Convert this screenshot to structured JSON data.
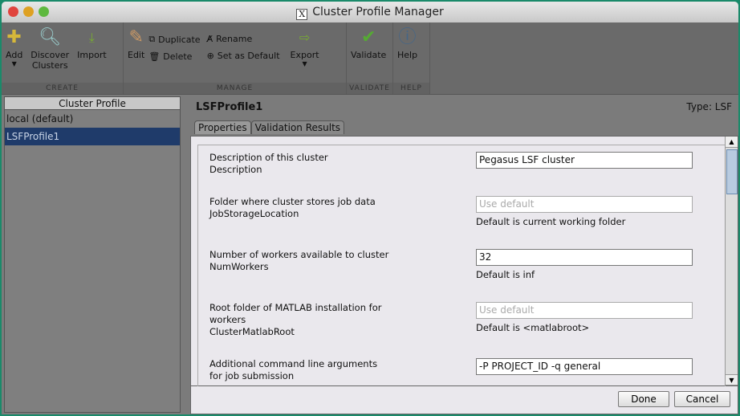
{
  "window": {
    "title": "Cluster Profile Manager",
    "title_icon": "X"
  },
  "toolbar": {
    "create": {
      "label": "CREATE",
      "add": "Add",
      "discover": "Discover\nClusters",
      "discover_l1": "Discover",
      "discover_l2": "Clusters",
      "import": "Import"
    },
    "manage": {
      "label": "MANAGE",
      "edit": "Edit",
      "duplicate": "Duplicate",
      "delete": "Delete",
      "rename": "Rename",
      "set_default": "Set as Default",
      "export": "Export"
    },
    "validate": {
      "label": "VALIDATE",
      "validate": "Validate"
    },
    "help": {
      "label": "HELP",
      "help": "Help"
    }
  },
  "sidebar": {
    "header": "Cluster Profile",
    "items": [
      {
        "label": "local (default)"
      },
      {
        "label": "LSFProfile1",
        "selected": true
      }
    ]
  },
  "main": {
    "profile_name": "LSFProfile1",
    "type": "Type: LSF",
    "tabs": [
      {
        "label": "Properties"
      },
      {
        "label": "Validation Results"
      }
    ],
    "properties": [
      {
        "desc": "Description of this cluster",
        "name": "Description",
        "value": "Pegasus LSF cluster",
        "placeholder": "",
        "hint": ""
      },
      {
        "desc": "Folder where cluster stores job data",
        "name": "JobStorageLocation",
        "value": "",
        "placeholder": "Use default",
        "hint": "Default is current working folder"
      },
      {
        "desc": "Number of workers available to cluster",
        "name": "NumWorkers",
        "value": "32",
        "placeholder": "",
        "hint": "Default is inf"
      },
      {
        "desc": "Root folder of MATLAB installation for workers",
        "name": "ClusterMatlabRoot",
        "value": "",
        "placeholder": "Use default",
        "hint": "Default is <matlabroot>"
      },
      {
        "desc": "Additional command line arguments for job submission",
        "name": "",
        "value": "-P PROJECT_ID -q general",
        "placeholder": "",
        "hint": ""
      }
    ],
    "done": "Done",
    "cancel": "Cancel"
  }
}
